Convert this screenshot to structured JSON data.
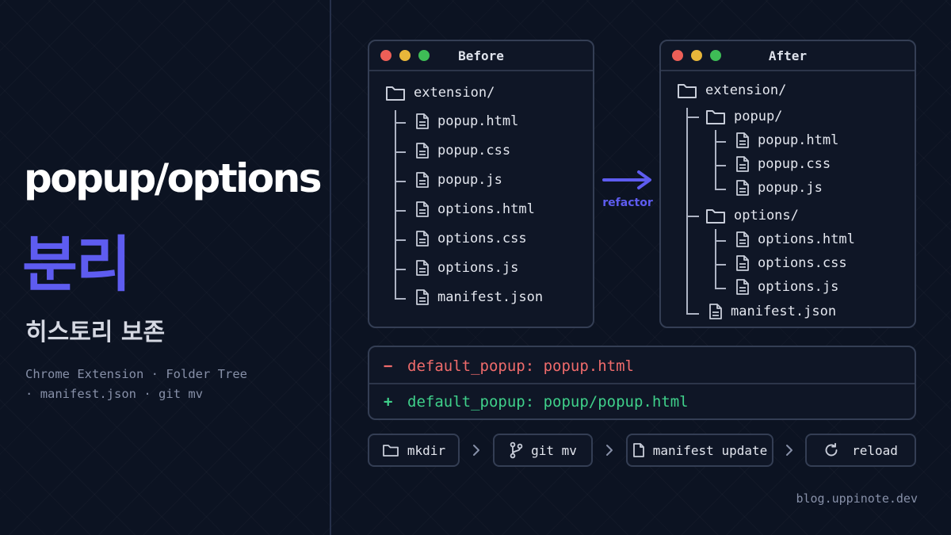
{
  "hero": {
    "title": "popup/options",
    "title_accent": "분리",
    "subtitle": "히스토리 보존",
    "tags": [
      "Chrome Extension",
      "Folder Tree",
      "manifest.json",
      "git mv"
    ],
    "tag_separator": "·"
  },
  "colors": {
    "accent": "#5e5cf0",
    "background": "#0c1322",
    "diff_removed": "#ef6b6b",
    "diff_added": "#3fd08a"
  },
  "before_window": {
    "title": "Before",
    "root": "extension/",
    "files": [
      "popup.html",
      "popup.css",
      "popup.js",
      "options.html",
      "options.css",
      "options.js",
      "manifest.json"
    ]
  },
  "arrow": {
    "label": "refactor"
  },
  "after_window": {
    "title": "After",
    "root": "extension/",
    "popup_folder": "popup/",
    "popup_files": [
      "popup.html",
      "popup.css",
      "popup.js"
    ],
    "options_folder": "options/",
    "options_files": [
      "options.html",
      "options.css",
      "options.js"
    ],
    "root_file": "manifest.json"
  },
  "diff": {
    "removed_sign": "−",
    "removed": "default_popup: popup.html",
    "added_sign": "+",
    "added": "default_popup: popup/popup.html"
  },
  "steps": [
    {
      "label": "mkdir",
      "icon": "folder-icon"
    },
    {
      "label": "git mv",
      "icon": "git-branch-icon"
    },
    {
      "label": "manifest update",
      "icon": "file-icon"
    },
    {
      "label": "reload",
      "icon": "refresh-icon"
    }
  ],
  "footer": "blog.uppinote.dev"
}
